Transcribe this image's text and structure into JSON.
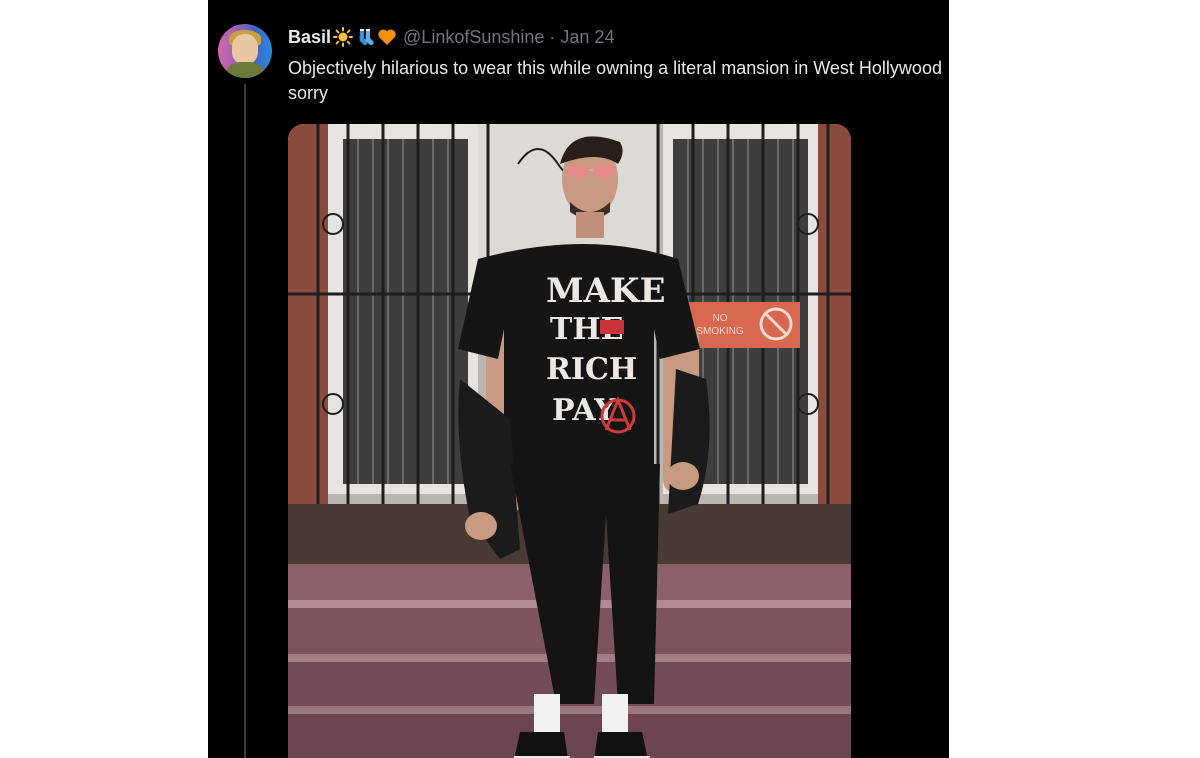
{
  "tweet": {
    "display_name": "Basil",
    "name_emojis": [
      "sun-emoji",
      "socks-emoji",
      "orange-heart-emoji"
    ],
    "handle": "@LinkofSunshine",
    "separator": "·",
    "date": "Jan 24",
    "text": "Objectively hilarious to wear this while owning a literal mansion in West Hollywood sorry"
  },
  "media": {
    "shirt_text": [
      "MAKE",
      "THE",
      "RICH",
      "PAY"
    ],
    "sign_text": [
      "NO",
      "SMOKING"
    ]
  },
  "colors": {
    "background": "#000000",
    "text_primary": "#e7e9ea",
    "text_secondary": "#71767b"
  }
}
